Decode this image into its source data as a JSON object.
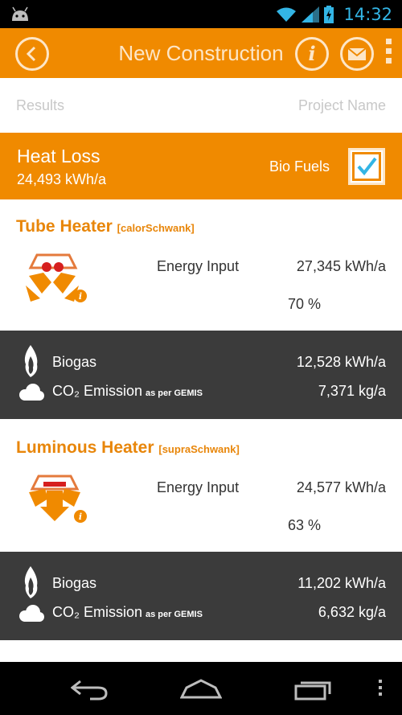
{
  "status_bar": {
    "time": "14:32"
  },
  "app_bar": {
    "title": "New Construction"
  },
  "subheader": {
    "left": "Results",
    "right": "Project Name"
  },
  "heat_loss": {
    "title": "Heat Loss",
    "value": "24,493 kWh/a",
    "bio_fuels_label": "Bio Fuels",
    "bio_fuels_checked": true
  },
  "heaters": [
    {
      "name": "Tube Heater",
      "brand": "[calorSchwank]",
      "energy_input_label": "Energy Input",
      "energy_input_value": "27,345 kWh/a",
      "efficiency": "70 %",
      "fuel_label": "Biogas",
      "fuel_value": "12,528 kWh/a",
      "co2_label": "CO₂ Emission",
      "co2_note": "as per GEMIS",
      "co2_value": "7,371 kg/a"
    },
    {
      "name": "Luminous Heater",
      "brand": "[supraSchwank]",
      "energy_input_label": "Energy Input",
      "energy_input_value": "24,577 kWh/a",
      "efficiency": "63 %",
      "fuel_label": "Biogas",
      "fuel_value": "11,202 kWh/a",
      "co2_label": "CO₂ Emission",
      "co2_note": "as per GEMIS",
      "co2_value": "6,632 kg/a"
    }
  ],
  "colors": {
    "accent": "#f08a00",
    "dark_band": "#3b3b3b",
    "status_blue": "#33b5e5"
  }
}
